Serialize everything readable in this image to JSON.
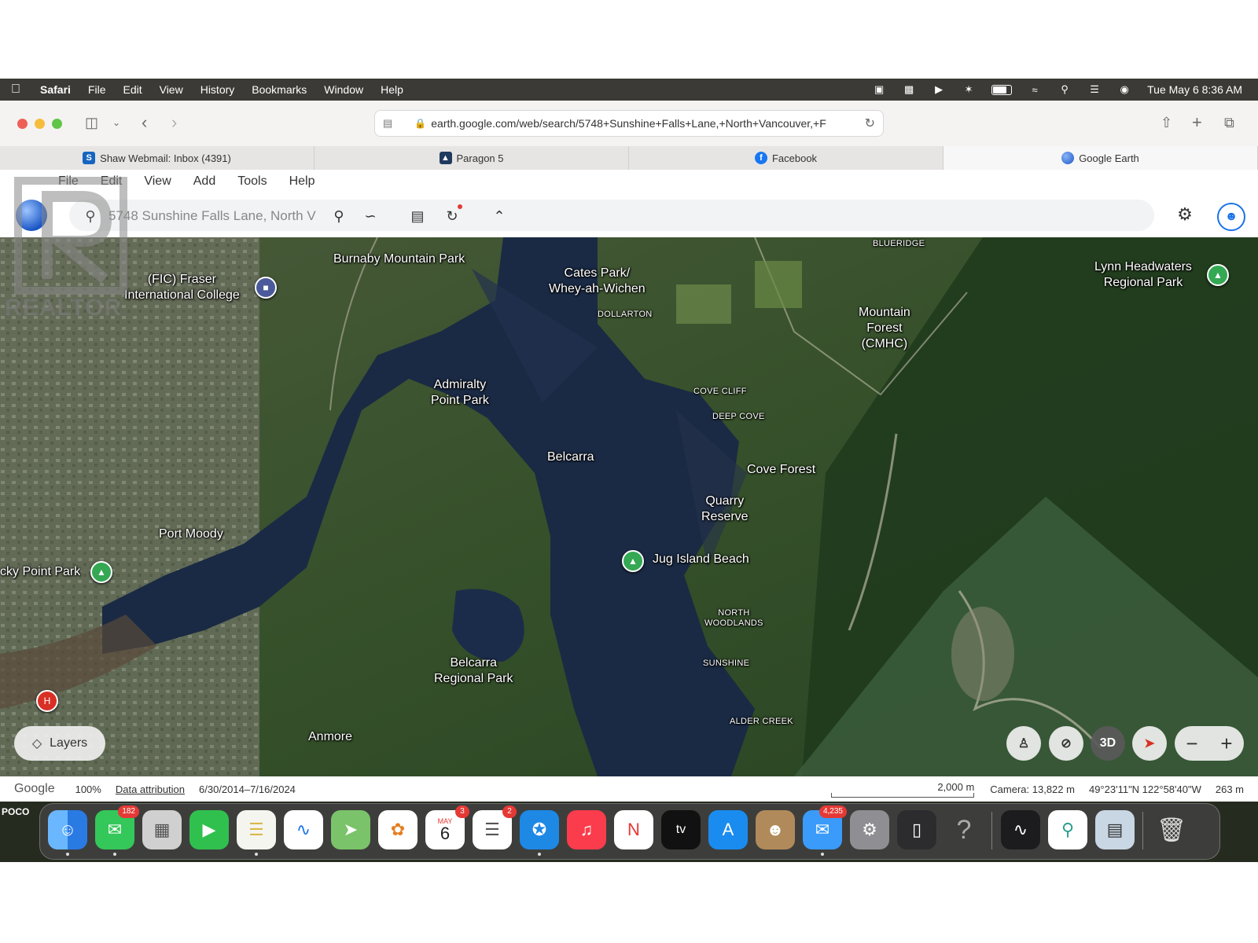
{
  "menubar": {
    "app": "Safari",
    "items": [
      "File",
      "Edit",
      "View",
      "History",
      "Bookmarks",
      "Window",
      "Help"
    ],
    "clock": "Tue May 6  8:36 AM"
  },
  "browser": {
    "url": "earth.google.com/web/search/5748+Sunshine+Falls+Lane,+North+Vancouver,+F",
    "tabs": [
      {
        "label": "Shaw Webmail: Inbox (4391)",
        "active": false,
        "favicon_color": "#1565c0"
      },
      {
        "label": "Paragon 5",
        "active": false,
        "favicon_color": "#1f3a5f"
      },
      {
        "label": "Facebook",
        "active": false,
        "favicon_color": "#1877f2"
      },
      {
        "label": "Google Earth",
        "active": true,
        "favicon_color": "#4285f4"
      }
    ]
  },
  "earth": {
    "menu": [
      "File",
      "Edit",
      "View",
      "Add",
      "Tools",
      "Help"
    ],
    "search_value": "5748 Sunshine Falls Lane, North V"
  },
  "map": {
    "labels": [
      {
        "text": "Burnaby Mountain Park"
      },
      {
        "text": "(FIC) Fraser\nInternational College"
      },
      {
        "text": "Cates Park/\nWhey-ah-Wichen"
      },
      {
        "text": "DOLLARTON"
      },
      {
        "text": "BLUERIDGE"
      },
      {
        "text": "Lynn Headwaters\nRegional Park"
      },
      {
        "text": "Mountain\nForest\n(CMHC)"
      },
      {
        "text": "Admiralty\nPoint Park"
      },
      {
        "text": "COVE CLIFF"
      },
      {
        "text": "DEEP COVE"
      },
      {
        "text": "Belcarra"
      },
      {
        "text": "Cove Forest"
      },
      {
        "text": "Quarry\nReserve"
      },
      {
        "text": "Port Moody"
      },
      {
        "text": "cky Point Park"
      },
      {
        "text": "Jug Island Beach"
      },
      {
        "text": "NORTH\nWOODLANDS"
      },
      {
        "text": "Belcarra\nRegional Park"
      },
      {
        "text": "SUNSHINE"
      },
      {
        "text": "ALDER CREEK"
      },
      {
        "text": "Anmore"
      }
    ],
    "layers_label": "Layers",
    "three_d_label": "3D",
    "zoom_out": "−",
    "zoom_in": "+"
  },
  "status": {
    "brand": "Google",
    "zoom": "100%",
    "attribution": "Data attribution",
    "dates": "6/30/2014–7/16/2024",
    "scale": "2,000 m",
    "camera": "Camera: 13,822 m",
    "coords": "49°23'11\"N 122°58'40\"W",
    "elevation": "263 m"
  },
  "dock": {
    "label": "POCO",
    "badges": {
      "messages": "182",
      "calendar": "3",
      "reminders": "2",
      "mail": "4,235"
    },
    "calendar_month": "MAY",
    "calendar_day": "6",
    "appletv": "tv"
  },
  "watermark": {
    "text": "REALTOR"
  }
}
